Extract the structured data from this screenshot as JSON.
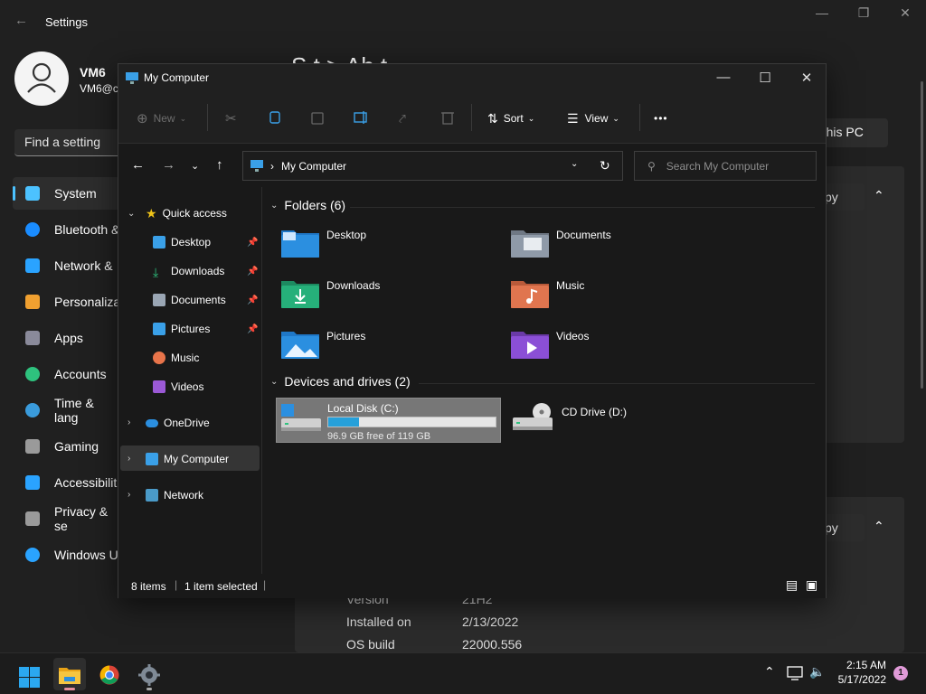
{
  "settings": {
    "title": "Settings",
    "user": {
      "name": "VM6",
      "email": "VM6@c"
    },
    "search_placeholder": "Find a setting",
    "nav": [
      {
        "label": "System",
        "color": "#4cc2ff"
      },
      {
        "label": "Bluetooth &",
        "color": "#1a8cff"
      },
      {
        "label": "Network &",
        "color": "#2aa3ff"
      },
      {
        "label": "Personaliza",
        "color": "#f0a030"
      },
      {
        "label": "Apps",
        "color": "#8a8a9a"
      },
      {
        "label": "Accounts",
        "color": "#2ec27e"
      },
      {
        "label": "Time & lang",
        "color": "#3a9bdc"
      },
      {
        "label": "Gaming",
        "color": "#9a9a9a"
      },
      {
        "label": "Accessibilit",
        "color": "#2aa3ff"
      },
      {
        "label": "Privacy & se",
        "color": "#9a9a9a"
      },
      {
        "label": "Windows U",
        "color": "#2aa3ff"
      }
    ],
    "heading_partial": "S t    >  Ab  t",
    "rename_button": "e this PC",
    "copy_button_1": "py",
    "copy_button_2": "py",
    "specs": [
      {
        "label": "Version",
        "value": "21H2"
      },
      {
        "label": "Installed on",
        "value": "2/13/2022"
      },
      {
        "label": "OS build",
        "value": "22000.556"
      }
    ]
  },
  "explorer": {
    "title": "My Computer",
    "toolbar": {
      "new_label": "New",
      "sort_label": "Sort",
      "view_label": "View",
      "more": "•••"
    },
    "address": "My Computer",
    "search_placeholder": "Search My Computer",
    "nav_pane": {
      "quick_access": "Quick access",
      "quick_items": [
        {
          "label": "Desktop",
          "pinned": true,
          "color": "#3aa0e8"
        },
        {
          "label": "Downloads",
          "pinned": true,
          "color": "#2ec27e"
        },
        {
          "label": "Documents",
          "pinned": true,
          "color": "#9aa6b4"
        },
        {
          "label": "Pictures",
          "pinned": true,
          "color": "#3aa0e8"
        },
        {
          "label": "Music",
          "pinned": false,
          "color": "#e8744a"
        },
        {
          "label": "Videos",
          "pinned": false,
          "color": "#9b59d6"
        }
      ],
      "onedrive": "OneDrive",
      "my_computer": "My Computer",
      "network": "Network"
    },
    "folders_header": "Folders (6)",
    "folders": [
      {
        "label": "Desktop",
        "color": "#2b8fe0",
        "icon": "desktop-folder-icon"
      },
      {
        "label": "Documents",
        "color": "#8f9aa8",
        "icon": "documents-folder-icon"
      },
      {
        "label": "Downloads",
        "color": "#26b07a",
        "icon": "downloads-folder-icon"
      },
      {
        "label": "Music",
        "color": "#e0754f",
        "icon": "music-folder-icon"
      },
      {
        "label": "Pictures",
        "color": "#2b8fe0",
        "icon": "pictures-folder-icon"
      },
      {
        "label": "Videos",
        "color": "#8b4fd6",
        "icon": "videos-folder-icon"
      }
    ],
    "drives_header": "Devices and drives (2)",
    "drives": [
      {
        "label": "Local Disk (C:)",
        "free_text": "96.9 GB free of 119 GB",
        "used_fraction": 0.186
      },
      {
        "label": "CD Drive (D:)"
      }
    ],
    "status": {
      "items": "8 items",
      "selected": "1 item selected"
    }
  },
  "taskbar": {
    "time": "2:15 AM",
    "date": "5/17/2022",
    "notification_count": "1",
    "apps": [
      "windows-start-icon",
      "file-explorer-icon",
      "chrome-icon",
      "settings-icon"
    ]
  }
}
